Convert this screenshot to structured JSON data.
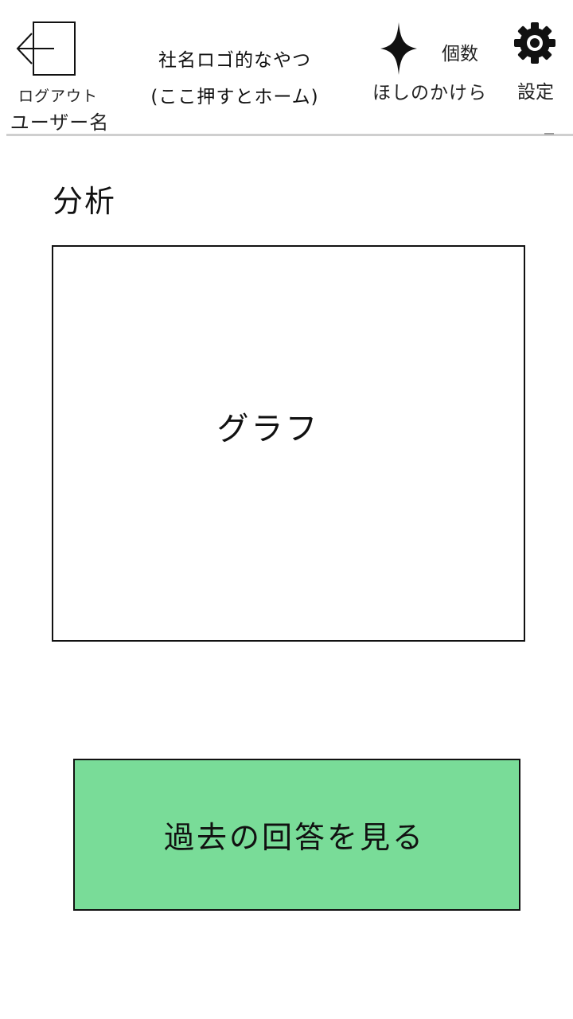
{
  "header": {
    "logout_label": "ログアウト",
    "username": "ユーザー名",
    "logo_line1": "社名ロゴ的なやつ",
    "logo_line2": "(ここ押すとホーム)",
    "count_label": "個数",
    "points_label": "ほしのかけら",
    "settings_label": "設定"
  },
  "main": {
    "title": "分析",
    "graph_placeholder": "グラフ",
    "history_button_label": "過去の回答を見る"
  },
  "icons": {
    "logout": "logout-icon",
    "star": "star-icon",
    "settings": "gear-icon"
  },
  "colors": {
    "history_button_bg": "#79dc98",
    "divider": "#cfcfcf"
  }
}
